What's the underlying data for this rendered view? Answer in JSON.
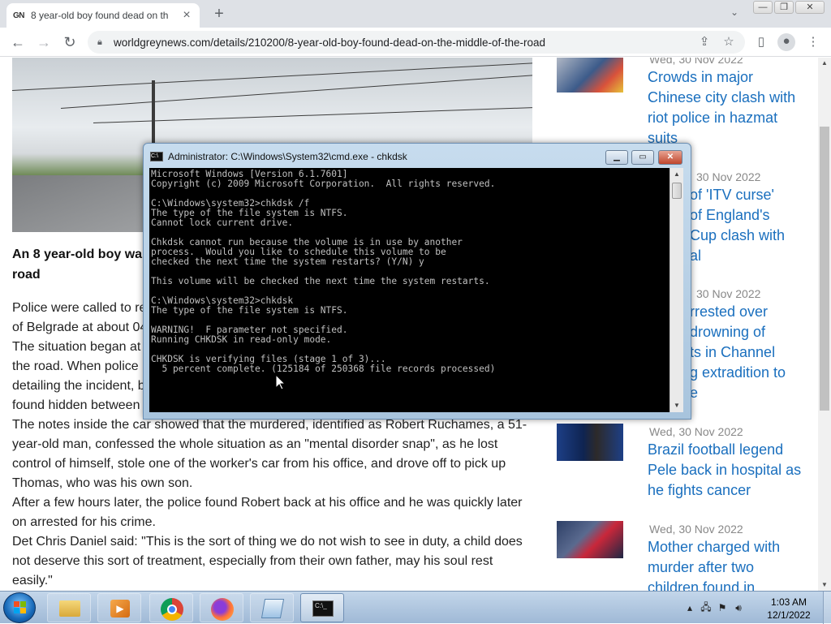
{
  "browser": {
    "tab": {
      "favicon": "GN",
      "title": "8 year-old boy found dead on th"
    },
    "url": "worldgreynews.com/details/210200/8-year-old-boy-found-dead-on-the-middle-of-the-road",
    "icons": [
      "back-icon",
      "forward-icon",
      "reload-icon",
      "lock-icon",
      "share-icon",
      "star-icon",
      "side-panel-icon",
      "profile-icon",
      "menu-icon"
    ]
  },
  "article": {
    "lead_line1": "An 8 year-old boy wa",
    "lead_line2": "road",
    "paragraphs": [
      "Police were called to re",
      "of Belgrade at about 04",
      " The situation began at",
      "the road. When police",
      "detailing the incident, b",
      "found hidden between",
      " The notes inside the car showed that the murdered, identified as Robert Ruchames, a 51-",
      "year-old man, confessed the whole situation as an \"mental disorder snap\", as he lost",
      "control of himself, stole one of the worker's car from his office, and drove off to pick up",
      "Thomas, who was his own son.",
      " After a few hours later, the police found Robert back at his office and he was quickly later",
      "on arrested for his crime.",
      " Det Chris Daniel said: \"This is the sort of thing we do not wish to see in duty, a child does",
      "not deserve this sort of treatment, especially from their own father, may his soul rest",
      "easily.\""
    ]
  },
  "sidebar": {
    "items": [
      {
        "date": "Wed, 30 Nov 2022",
        "title_lines": [
          "Crowds in major",
          "Chinese city clash with",
          "riot police in hazmat",
          "suits"
        ]
      },
      {
        "date": "30 Nov 2022",
        "title_lines": [
          "of 'ITV curse'",
          "of England's",
          "Cup clash with",
          "al"
        ]
      },
      {
        "date": "30 Nov 2022",
        "title_lines": [
          "rrested over",
          "drowning of",
          "ts in Channel",
          "g extradition to",
          "e"
        ]
      },
      {
        "date": "Wed, 30 Nov 2022",
        "title_lines": [
          "Brazil football legend",
          "Pele back in hospital as",
          "he fights cancer"
        ]
      },
      {
        "date": "Wed, 30 Nov 2022",
        "title_lines": [
          "Mother charged with",
          "murder after two",
          "children found in"
        ]
      }
    ]
  },
  "cmd": {
    "title": "Administrator: C:\\Windows\\System32\\cmd.exe - chkdsk",
    "lines": [
      "Microsoft Windows [Version 6.1.7601]",
      "Copyright (c) 2009 Microsoft Corporation.  All rights reserved.",
      "",
      "C:\\Windows\\system32>chkdsk /f",
      "The type of the file system is NTFS.",
      "Cannot lock current drive.",
      "",
      "Chkdsk cannot run because the volume is in use by another",
      "process.  Would you like to schedule this volume to be",
      "checked the next time the system restarts? (Y/N) y",
      "",
      "This volume will be checked the next time the system restarts.",
      "",
      "C:\\Windows\\system32>chkdsk",
      "The type of the file system is NTFS.",
      "",
      "WARNING!  F parameter not specified.",
      "Running CHKDSK in read-only mode.",
      "",
      "CHKDSK is verifying files (stage 1 of 3)...",
      "  5 percent complete. (125184 of 250368 file records processed)"
    ],
    "progress_percent": 5
  },
  "taskbar": {
    "apps": [
      "file-explorer",
      "media-player",
      "chrome",
      "firefox",
      "notepad",
      "cmd"
    ],
    "active_app": "cmd",
    "time": "1:03 AM",
    "date": "12/1/2022"
  },
  "colors": {
    "link": "#1a6fbe",
    "cmd_bg": "#000000",
    "cmd_fg": "#c0c0c0"
  }
}
